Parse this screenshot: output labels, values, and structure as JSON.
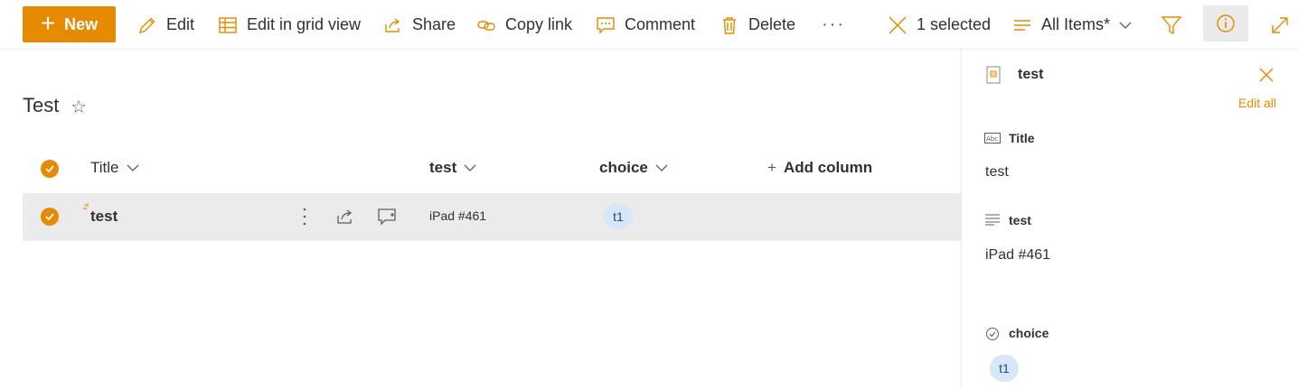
{
  "toolbar": {
    "new_label": "New",
    "edit_label": "Edit",
    "grid_label": "Edit in grid view",
    "share_label": "Share",
    "copy_link_label": "Copy link",
    "comment_label": "Comment",
    "delete_label": "Delete",
    "more_label": "···",
    "selected_label": "1 selected",
    "view_label": "All Items*",
    "accent_color": "#e68a00"
  },
  "list": {
    "title": "Test",
    "columns": {
      "title": "Title",
      "test": "test",
      "choice": "choice",
      "add": "Add column"
    },
    "rows": [
      {
        "title": "test",
        "test": "iPad #461",
        "choice": "t1",
        "selected": true
      }
    ]
  },
  "details": {
    "title": "test",
    "edit_all": "Edit all",
    "fields": [
      {
        "label": "Title",
        "value": "test",
        "icon": "text-field-icon"
      },
      {
        "label": "test",
        "value": "iPad #461",
        "icon": "multiline-text-icon"
      },
      {
        "label": "choice",
        "value": "t1",
        "icon": "choice-icon"
      }
    ]
  }
}
